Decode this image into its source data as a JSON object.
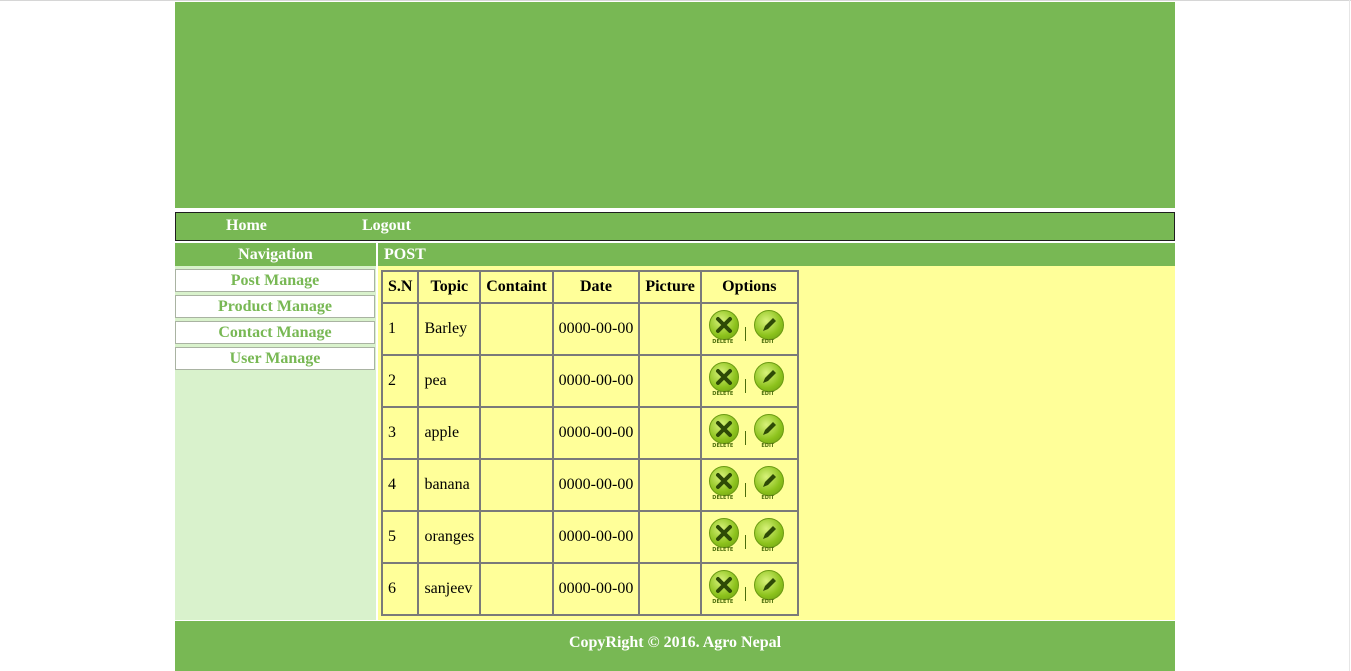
{
  "nav": {
    "home": "Home",
    "logout": "Logout"
  },
  "sidebar": {
    "heading": "Navigation",
    "items": [
      "Post Manage",
      "Product Manage",
      "Contact Manage",
      "User Manage"
    ]
  },
  "main": {
    "heading": "POST",
    "table": {
      "columns": [
        "S.N",
        "Topic",
        "Containt",
        "Date",
        "Picture",
        "Options"
      ],
      "rows": [
        {
          "sn": "1",
          "topic": "Barley",
          "containt": "",
          "date": "0000-00-00",
          "picture": ""
        },
        {
          "sn": "2",
          "topic": "pea",
          "containt": "",
          "date": "0000-00-00",
          "picture": ""
        },
        {
          "sn": "3",
          "topic": "apple",
          "containt": "",
          "date": "0000-00-00",
          "picture": ""
        },
        {
          "sn": "4",
          "topic": "banana",
          "containt": "",
          "date": "0000-00-00",
          "picture": ""
        },
        {
          "sn": "5",
          "topic": "oranges",
          "containt": "",
          "date": "0000-00-00",
          "picture": ""
        },
        {
          "sn": "6",
          "topic": "sanjeev",
          "containt": "",
          "date": "0000-00-00",
          "picture": ""
        }
      ],
      "delete_label": "DELETE",
      "edit_label": "EDIT"
    }
  },
  "footer": {
    "text": "CopyRight © 2016. Agro Nepal"
  },
  "colors": {
    "green": "#78b854",
    "yellow": "#ffff99",
    "sidebar_bg": "#d9f2cc"
  },
  "icons": {
    "delete": "delete-x-icon",
    "edit": "edit-pencil-icon"
  }
}
